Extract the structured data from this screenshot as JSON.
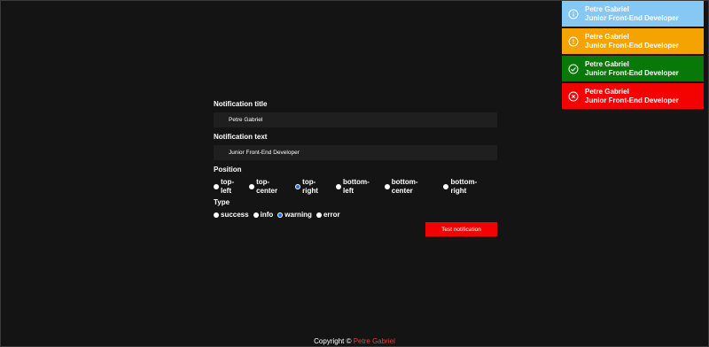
{
  "toasts": [
    {
      "type": "info",
      "icon": "info-icon",
      "title": "Petre Gabriel",
      "text": "Junior Front-End Developer",
      "color": "#86c8f4"
    },
    {
      "type": "warning",
      "icon": "warning-icon",
      "title": "Petre Gabriel",
      "text": "Junior Front-End Developer",
      "color": "#f5a300"
    },
    {
      "type": "success",
      "icon": "check-icon",
      "title": "Petre Gabriel",
      "text": "Junior Front-End Developer",
      "color": "#087908"
    },
    {
      "type": "error",
      "icon": "close-icon",
      "title": "Petre Gabriel",
      "text": "Junior Front-End Developer",
      "color": "#f40202"
    }
  ],
  "form": {
    "title_label": "Notification title",
    "title_value": "Petre Gabriel",
    "text_label": "Notification text",
    "text_value": "Junior Front-End Developer",
    "position_label": "Position",
    "positions": [
      "top-left",
      "top-center",
      "top-right",
      "bottom-left",
      "bottom-center",
      "bottom-right"
    ],
    "position_selected": "top-right",
    "type_label": "Type",
    "types": [
      "success",
      "info",
      "warning",
      "error"
    ],
    "type_selected": "warning",
    "button_label": "Test notification"
  },
  "footer": {
    "prefix": "Copyright © ",
    "name": "Petre Gabriel"
  },
  "colors": {
    "background": "#141414",
    "accent": "#f40202",
    "radio_checked": "#1b6ef3"
  }
}
